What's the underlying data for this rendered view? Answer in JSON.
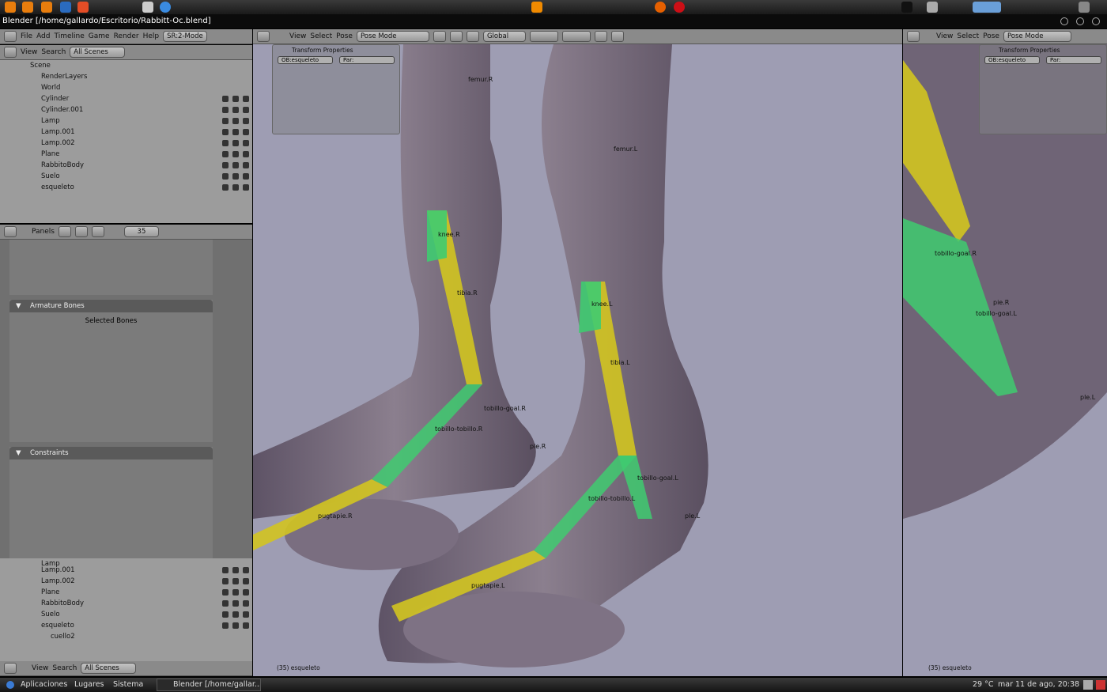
{
  "window_title": "Blender [/home/gallardo/Escritorio/Rabbitt-Oc.blend]",
  "menu": {
    "file": "File",
    "add": "Add",
    "timeline": "Timeline",
    "game": "Game",
    "render": "Render",
    "help": "Help",
    "screen": "SR:2-Mode"
  },
  "outliner": {
    "view": "View",
    "search": "Search",
    "scope": "All Scenes",
    "rows": [
      "Scene",
      "RenderLayers",
      "World",
      "Cylinder",
      "Cylinder.001",
      "Lamp",
      "Lamp.001",
      "Lamp.002",
      "Plane",
      "RabbitoBody",
      "Suelo",
      "esqueleto"
    ]
  },
  "buttons": {
    "panels": "Panels",
    "frame": "35",
    "armature_title": "Armature Bones",
    "selected_bones": "Selected Bones",
    "constraints_title": "Constraints"
  },
  "outliner2": {
    "rows": [
      "Lamp",
      "Lamp.001",
      "Lamp.002",
      "Plane",
      "RabbitoBody",
      "Suelo",
      "esqueleto",
      "cuello2"
    ],
    "view": "View",
    "search": "Search",
    "scope": "All Scenes"
  },
  "viewport": {
    "view": "View",
    "select": "Select",
    "pose": "Pose",
    "mode": "Pose Mode",
    "orientation": "Global",
    "transform_title": "Transform Properties",
    "ob_field": "OB:esqueleto",
    "par_field": "Par:",
    "status": "(35) esqueleto",
    "bone_labels": {
      "fmr_top": "femur.R",
      "femur_l": "femur.L",
      "knee_r": "knee.R",
      "tibia_r": "tibia.R",
      "knee_l": "knee.L",
      "tibia_l": "tibia.L",
      "tobillo_goal_r": "tobillo-goal.R",
      "tobillo_r": "tobillo-tobillo.R",
      "ple_r": "ple.R",
      "dedo_r": "pugtapie.R",
      "tobillo_goal_l": "tobillo-goal.L",
      "tobillo_l": "tobillo-tobillo.L",
      "ple_l": "ple.L",
      "dedo_l": "pugtapie.L"
    }
  },
  "viewport_right": {
    "view": "View",
    "select": "Select",
    "pose": "Pose",
    "mode": "Pose Mode",
    "transform_title": "Transform Properties",
    "ob_field": "OB:esqueleto",
    "par_field": "Par:",
    "status": "(35) esqueleto",
    "labels": {
      "goal": "tobillo-goal.R",
      "goal2": "tobillo-goal.L",
      "pie": "pie.R",
      "ple": "ple.L"
    }
  },
  "taskbar": {
    "apps": "Aplicaciones",
    "places": "Lugares",
    "system": "Sistema",
    "task": "Blender [/home/gallar...",
    "temp": "29 °C",
    "clock": "mar 11 de ago, 20:38"
  }
}
